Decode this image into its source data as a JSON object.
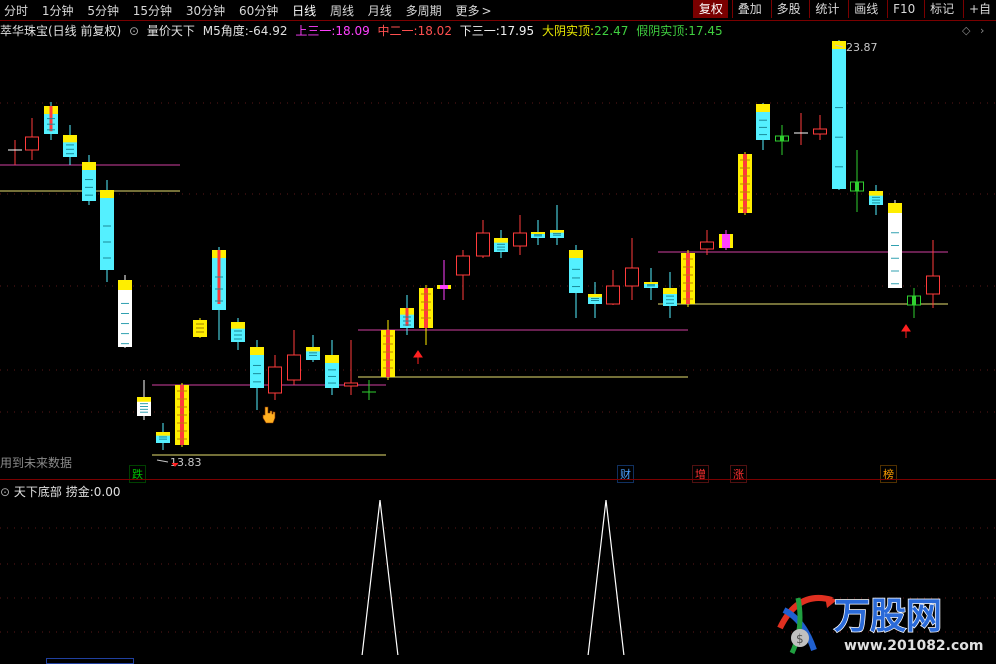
{
  "toolbar": {
    "periods": [
      "分时",
      "1分钟",
      "5分钟",
      "15分钟",
      "30分钟",
      "60分钟",
      "日线",
      "周线",
      "月线",
      "多周期",
      "更多"
    ],
    "active_period": "日线",
    "more_arrow": ">",
    "right_buttons": [
      "复权",
      "叠加",
      "多股",
      "统计",
      "画线",
      "F10",
      "标记",
      "+自"
    ],
    "selected_right": "复权"
  },
  "main_info": {
    "stock_title": "萃华珠宝(日线 前复权)",
    "indicator_name": "量价天下",
    "m5_label": "M5角度:",
    "m5_value": "-64.92",
    "up3_label": "上三一:",
    "up3_value": "18.09",
    "mid2_label": "中二一:",
    "mid2_value": "18.02",
    "down3_label": "下三一:",
    "down3_value": "17.95",
    "big_yin_label": "大阴实顶:",
    "big_yin_value": "22.47",
    "fake_yin_label": "假阴实顶:",
    "fake_yin_value": "17.45"
  },
  "price_labels": {
    "high": "23.87",
    "low": "13.83"
  },
  "future_data_note": "用到未来数据",
  "event_markers": [
    {
      "text": "跌",
      "color": "#00c000"
    },
    {
      "text": "财",
      "color": "#4aa0ff"
    },
    {
      "text": "增",
      "color": "#ff3030"
    },
    {
      "text": "涨",
      "color": "#ff3030"
    },
    {
      "text": "榜",
      "color": "#ffa000"
    }
  ],
  "lower_info": {
    "indicator_name": "天下底部",
    "value_label": "捞金:",
    "value": "0.00"
  },
  "colors": {
    "up": "#ff3b3b",
    "down_cyan": "#54f0ff",
    "yellow": "#ffee00",
    "magenta": "#ff40ff",
    "line_magenta": "#d040a0",
    "line_yellow": "#e8e070",
    "divider": "#7a0000"
  },
  "watermark": {
    "brand": "万股网",
    "url": "www.201082.com"
  }
}
